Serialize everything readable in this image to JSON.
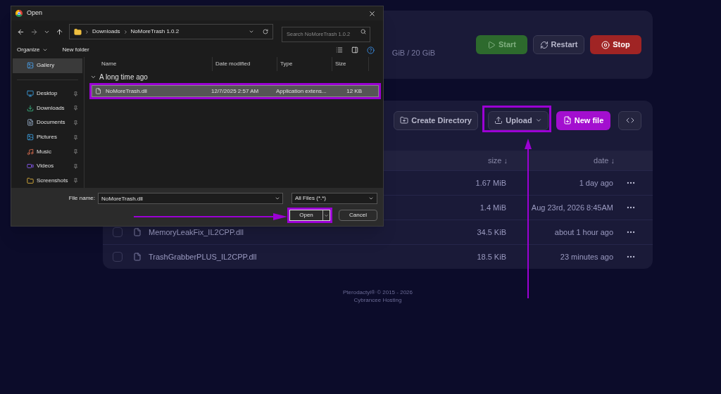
{
  "server_card": {
    "disk_usage": "GiB / 20 GiB",
    "buttons": [
      {
        "label": "Start",
        "kind": "start"
      },
      {
        "label": "Restart",
        "kind": "restart"
      },
      {
        "label": "Stop",
        "kind": "stop"
      }
    ]
  },
  "file_toolbar": {
    "create_directory": "Create Directory",
    "upload": "Upload",
    "new_file": "New file"
  },
  "table": {
    "columns": [
      "size ↓",
      "date ↓"
    ],
    "rows": [
      {
        "name": "",
        "size": "1.67 MiB",
        "date": "1 day ago"
      },
      {
        "name": "",
        "size": "1.4 MiB",
        "date": "Aug 23rd, 2026 8:45AM"
      },
      {
        "name": "MemoryLeakFix_IL2CPP.dll",
        "size": "34.5 KiB",
        "date": "about 1 hour ago",
        "checked": false
      },
      {
        "name": "TrashGrabberPLUS_IL2CPP.dll",
        "size": "18.5 KiB",
        "date": "23 minutes ago",
        "checked": false
      }
    ]
  },
  "footer": [
    "Pterodactyl® © 2015 - 2026",
    "Cybrancee Hosting"
  ],
  "dialog": {
    "title": "Open",
    "breadcrumb": [
      "Downloads",
      "NoMoreTrash 1.0.2"
    ],
    "search": {
      "placeholder": "Search NoMoreTrash 1.0.2"
    },
    "toolbar": [
      "Organize",
      "New folder"
    ],
    "sidebar": [
      {
        "label": "Gallery",
        "selected": true,
        "pinned": false
      },
      {
        "label": "Desktop",
        "selected": false,
        "pinned": true
      },
      {
        "label": "Downloads",
        "selected": false,
        "pinned": true
      },
      {
        "label": "Documents",
        "selected": false,
        "pinned": true
      },
      {
        "label": "Pictures",
        "selected": false,
        "pinned": true
      },
      {
        "label": "Music",
        "selected": false,
        "pinned": true
      },
      {
        "label": "Videos",
        "selected": false,
        "pinned": true
      },
      {
        "label": "Screenshots",
        "selected": false,
        "pinned": true
      }
    ],
    "columns": [
      "Name",
      "Date modified",
      "Type",
      "Size"
    ],
    "group": "A long time ago",
    "files": [
      {
        "name": "NoMoreTrash.dll",
        "date": "12/7/2025 2:57 AM",
        "type": "Application extens...",
        "size": "12 KB",
        "selected": true
      }
    ],
    "file_name_label": "File name:",
    "file_name": "NoMoreTrash.dll",
    "filter": "All Files (*.*)",
    "open": "Open",
    "cancel": "Cancel"
  }
}
